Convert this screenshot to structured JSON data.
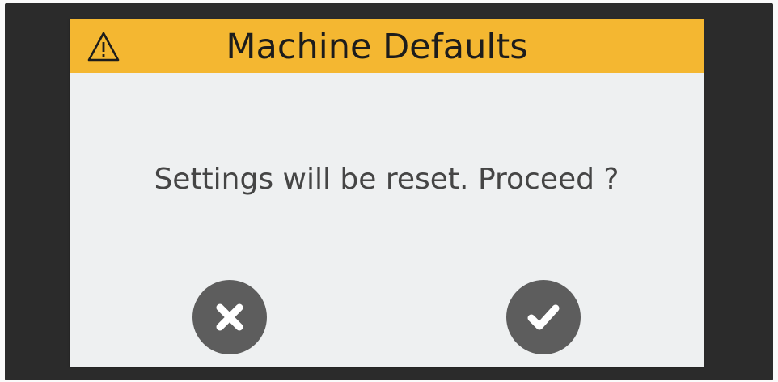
{
  "dialog": {
    "title": "Machine Defaults",
    "message": "Settings will be reset. Proceed ?",
    "header_color": "#f4b731",
    "header_icon": "warning-icon",
    "buttons": [
      {
        "icon": "close-icon",
        "action": "cancel"
      },
      {
        "icon": "check-icon",
        "action": "confirm"
      }
    ],
    "button_color": "#5d5d5d"
  }
}
